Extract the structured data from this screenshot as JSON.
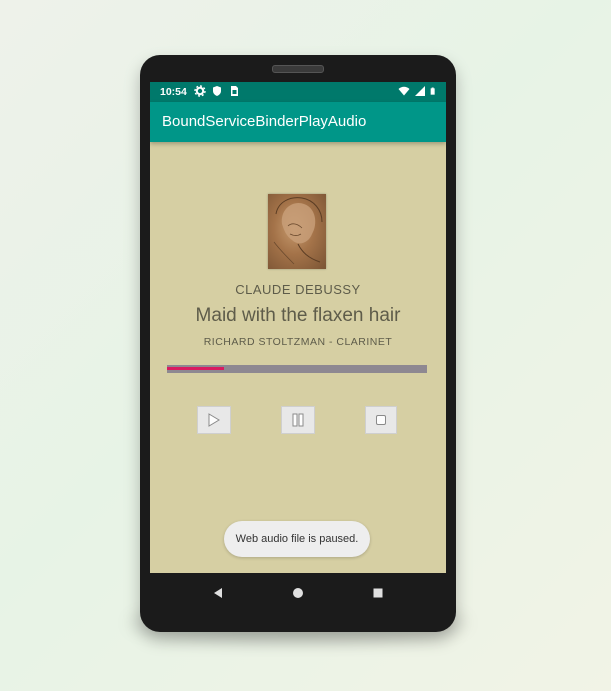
{
  "status_bar": {
    "time": "10:54",
    "icons_left": [
      "gear-icon",
      "shield-icon",
      "sim-card-icon"
    ],
    "icons_right": [
      "wifi-icon",
      "signal-icon",
      "battery-icon"
    ]
  },
  "app_bar": {
    "title": "BoundServiceBinderPlayAudio",
    "color": "#009688",
    "status_color": "#00796b"
  },
  "player": {
    "composer": "CLAUDE DEBUSSY",
    "title": "Maid with the flaxen hair",
    "performer": "RICHARD STOLTZMAN - CLARINET",
    "progress": 0.22,
    "progress_color": "#d81b60",
    "background_color": "#d6cfa3",
    "album_art_icon": "portrait-artwork",
    "controls": [
      {
        "name": "play",
        "icon": "play-icon"
      },
      {
        "name": "pause",
        "icon": "pause-icon"
      },
      {
        "name": "stop",
        "icon": "stop-icon"
      }
    ]
  },
  "toast": {
    "message": "Web audio file is paused."
  },
  "nav_bar": {
    "buttons": [
      "back-icon",
      "home-icon",
      "recents-icon"
    ]
  }
}
